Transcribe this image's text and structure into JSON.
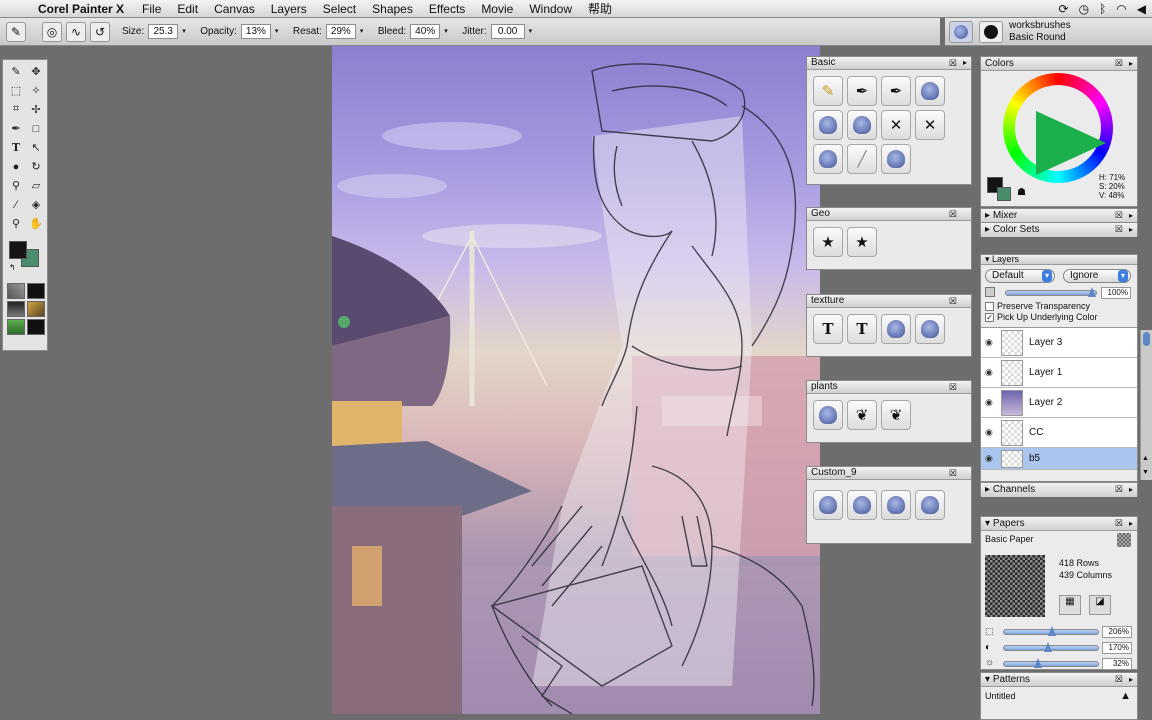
{
  "menubar": {
    "app_name": "Corel Painter X",
    "menus": [
      "File",
      "Edit",
      "Canvas",
      "Layers",
      "Select",
      "Shapes",
      "Effects",
      "Movie",
      "Window",
      "帮助"
    ]
  },
  "propbar": {
    "size_label": "Size:",
    "size_value": "25.3",
    "opacity_label": "Opacity:",
    "opacity_value": "13%",
    "resat_label": "Resat:",
    "resat_value": "29%",
    "bleed_label": "Bleed:",
    "bleed_value": "40%",
    "jitter_label": "Jitter:",
    "jitter_value": "0.00"
  },
  "brush_selector": {
    "category": "worksbrushes",
    "variant": "Basic Round"
  },
  "toolbox": {
    "foreground_color": "#141414",
    "background_color": "#4a8d6c"
  },
  "palettes": [
    {
      "title": "Basic",
      "items": [
        "pencil",
        "pen",
        "pen",
        "blob",
        "blob",
        "blob",
        "crossed",
        "crossed",
        "blob",
        "slash",
        "blob"
      ]
    },
    {
      "title": "Geo",
      "items": [
        "star",
        "star"
      ]
    },
    {
      "title": "textture",
      "items": [
        "T",
        "T",
        "blob",
        "blob"
      ]
    },
    {
      "title": "plants",
      "items": [
        "blob",
        "leaf",
        "leaf"
      ]
    },
    {
      "title": "Custom_9",
      "items": [
        "blob",
        "blob",
        "blob",
        "blob"
      ]
    }
  ],
  "colors": {
    "title": "Colors",
    "h": "H: 71%",
    "s": "S: 20%",
    "v": "V: 48%",
    "accent": "#1cb04c"
  },
  "mixer": {
    "title": "Mixer"
  },
  "color_sets": {
    "title": "Color Sets"
  },
  "layers": {
    "title": "Layers",
    "composite_method": "Default",
    "composite_depth": "Ignore",
    "opacity": "100%",
    "preserve_transparency": "Preserve Transparency",
    "pick_up_underlying": "Pick Up Underlying Color",
    "items": [
      {
        "name": "Layer 3"
      },
      {
        "name": "Layer 1"
      },
      {
        "name": "Layer 2"
      },
      {
        "name": "CC"
      },
      {
        "name": "b5"
      }
    ]
  },
  "channels": {
    "title": "Channels"
  },
  "papers": {
    "title": "Papers",
    "selected": "Basic Paper",
    "rows": "418 Rows",
    "columns": "439 Columns",
    "scale": "206%",
    "contrast": "170%",
    "brightness": "32%"
  },
  "patterns": {
    "title": "Patterns",
    "selected": "Untitled"
  }
}
